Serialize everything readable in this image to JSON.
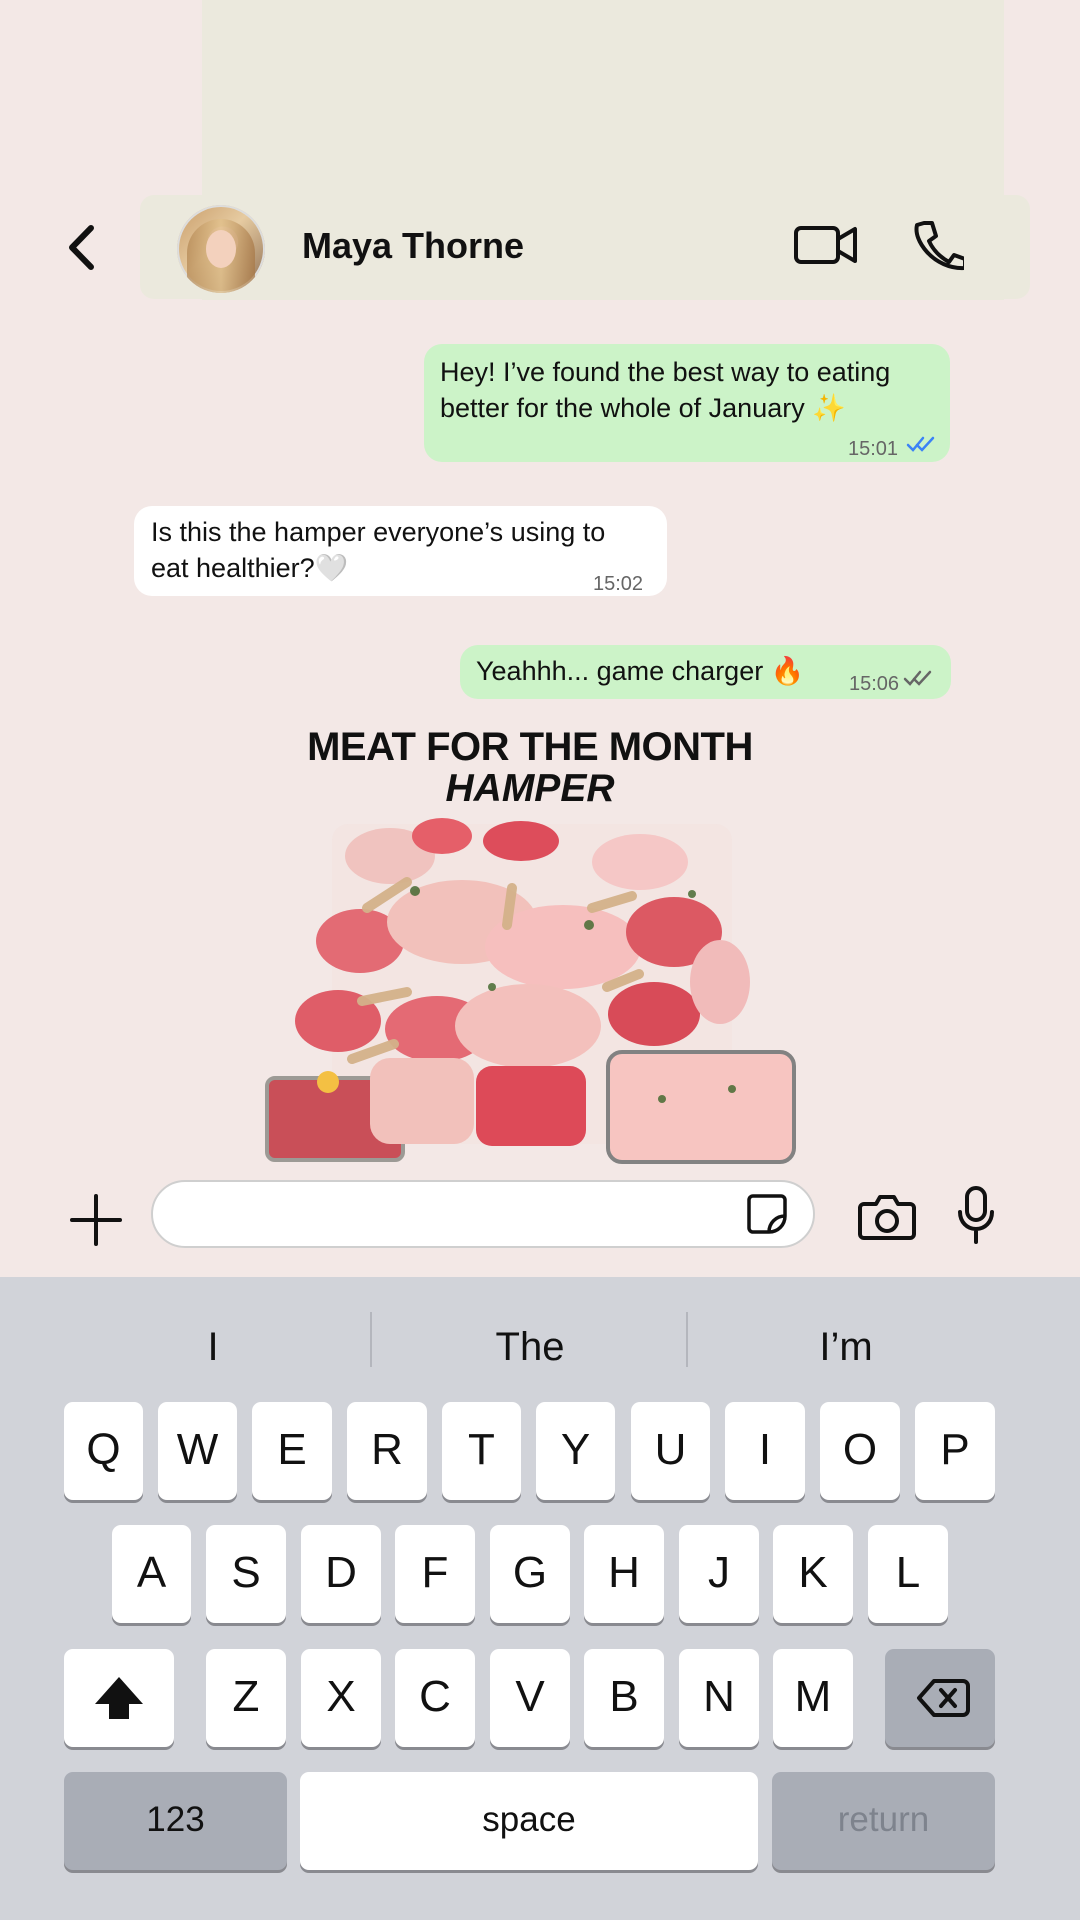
{
  "header": {
    "contact_name": "Maya Thorne",
    "icons": {
      "back": "chevron-left-icon",
      "avatar": "profile-photo",
      "video": "video-camera-icon",
      "call": "phone-icon"
    }
  },
  "messages": [
    {
      "direction": "outgoing",
      "lines": [
        "Hey! I’ve found the best way to eating",
        "better for the whole of January ✨"
      ],
      "time": "15:01",
      "status": "read"
    },
    {
      "direction": "incoming",
      "lines": [
        "Is this the hamper everyone’s using to",
        "eat healthier?🤍"
      ],
      "time": "15:02"
    },
    {
      "direction": "outgoing",
      "lines": [
        "Yeahhh... game charger 🔥"
      ],
      "time": "15:06",
      "status": "delivered"
    }
  ],
  "promo": {
    "title": "MEAT FOR THE MONTH",
    "subtitle": "HAMPER"
  },
  "composer": {
    "placeholder": "",
    "icons": {
      "plus": "plus-icon",
      "sticker": "sticker-icon",
      "camera": "camera-icon",
      "microphone": "microphone-icon"
    }
  },
  "keyboard": {
    "suggestions": [
      "I",
      "The",
      "I’m"
    ],
    "rows": [
      [
        "Q",
        "W",
        "E",
        "R",
        "T",
        "Y",
        "U",
        "I",
        "O",
        "P"
      ],
      [
        "A",
        "S",
        "D",
        "F",
        "G",
        "H",
        "J",
        "K",
        "L"
      ],
      [
        "Z",
        "X",
        "C",
        "V",
        "B",
        "N",
        "M"
      ]
    ],
    "shift": "shift-icon",
    "delete": "delete-icon",
    "numbers": "123",
    "space": "space",
    "return": "return"
  },
  "colors": {
    "background": "#f3e8e6",
    "outgoing_bubble": "#ccf3c8",
    "incoming_bubble": "#ffffff",
    "read_ticks": "#3b82f6",
    "keyboard": "#d1d3d9"
  }
}
